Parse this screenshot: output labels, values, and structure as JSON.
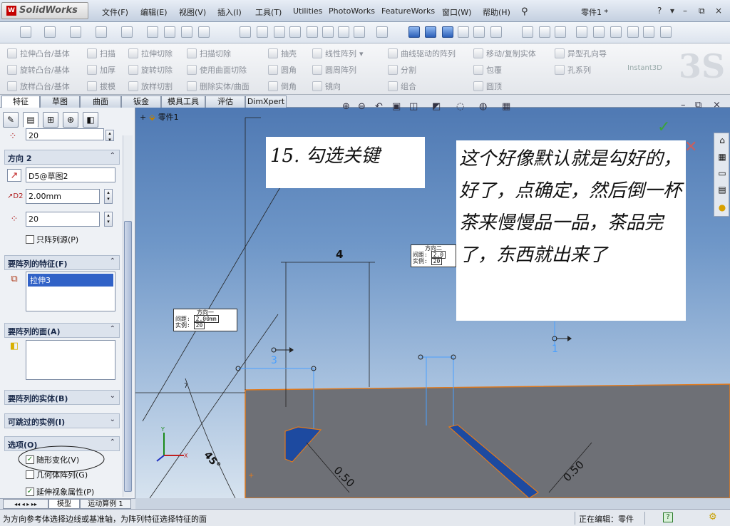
{
  "app": {
    "name": "SolidWorks",
    "document_title": "零件1 *"
  },
  "menu": [
    "文件(F)",
    "编辑(E)",
    "视图(V)",
    "插入(I)",
    "工具(T)",
    "Utilities",
    "PhotoWorks",
    "FeatureWorks",
    "窗口(W)",
    "帮助(H)"
  ],
  "window_controls": {
    "help": "?",
    "min": "–",
    "restore": "⧉",
    "close": "×"
  },
  "command_manager": {
    "col1": [
      "拉伸凸台/基体",
      "旋转凸台/基体",
      "放样凸台/基体"
    ],
    "col2": [
      "扫描",
      "加厚",
      "拔模"
    ],
    "col3": [
      "拉伸切除",
      "旋转切除",
      "放样切割"
    ],
    "col4": [
      "扫描切除",
      "使用曲面切除",
      "删除实体/曲面"
    ],
    "col5": [
      "抽壳",
      "圆角",
      "倒角"
    ],
    "col6": [
      "线性阵列",
      "圆周阵列",
      "镜向"
    ],
    "col7": [
      "曲线驱动的阵列",
      "分割",
      "组合"
    ],
    "col8": [
      "移动/复制实体",
      "包覆",
      "圆顶"
    ],
    "col9": [
      "异型孔向导",
      "孔系列"
    ],
    "instant3d": "Instant3D"
  },
  "tabs": [
    "特征",
    "草图",
    "曲面",
    "钣金",
    "模具工具",
    "评估",
    "DimXpert"
  ],
  "active_tab": "特征",
  "property_manager": {
    "top_field_value": "20",
    "dir2": {
      "title": "方向 2",
      "reference": "D5@草图2",
      "spacing": "2.00mm",
      "instances": "20",
      "only_seed_label": "只阵列源(P)"
    },
    "features": {
      "title": "要阵列的特征(F)",
      "item": "拉伸3"
    },
    "faces": {
      "title": "要阵列的面(A)"
    },
    "bodies": {
      "title": "要阵列的实体(B)"
    },
    "skip": {
      "title": "可跳过的实例(I)"
    },
    "options": {
      "title": "选项(O)",
      "vary_sketch": "随形变化(V)",
      "geometry_pattern": "几何体阵列(G)",
      "propagate_visual": "延伸视象属性(P)"
    }
  },
  "viewport": {
    "tree_root": "零件1",
    "annotation_step": "15. 勾选关键",
    "annotation_note": "这个好像默认就是勾好的，好了，点确定，然后倒一杯茶来慢慢品一品，茶品完了，东西就出来了",
    "dir1_box": {
      "title": "方向一",
      "spacing_label": "间距:",
      "spacing": "2.00mm",
      "instances_label": "实例:",
      "instances": "20"
    },
    "dir2_box": {
      "title": "方向二",
      "spacing_label": "间距:",
      "spacing": "2.0",
      "instances_label": "实例:",
      "instances": "20"
    },
    "dim_top": "4",
    "dim_left": "0.50",
    "dim_right": "0.50",
    "angle": "45°",
    "marker_3": "3",
    "marker_1": "1",
    "marker_7": "7"
  },
  "bottom_tabs": [
    "模型",
    "运动算例 1"
  ],
  "status": {
    "message": "为方向参考体选择边线或基准轴，为阵列特征选择特征的面",
    "editing": "正在编辑：零件",
    "help_icon": "?"
  },
  "colors": {
    "viewport_top": "#4f79b3",
    "part_face": "#6f7177",
    "edge": "#e07a1e",
    "slot": "#1d4aa0",
    "pattern_blue": "#4aa0ff"
  }
}
